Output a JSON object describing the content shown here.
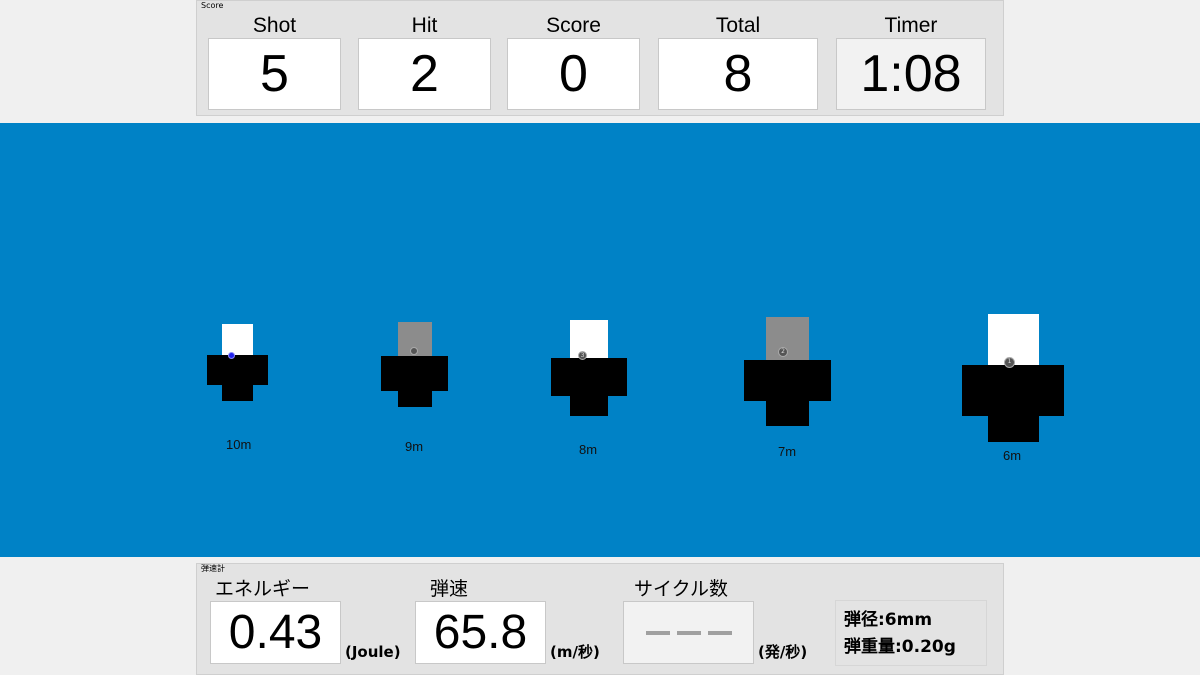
{
  "score_panel": {
    "caption": "Score",
    "columns": [
      {
        "label": "Shot",
        "value": "5"
      },
      {
        "label": "Hit",
        "value": "2"
      },
      {
        "label": "Score",
        "value": "0"
      },
      {
        "label": "Total",
        "value": "8"
      },
      {
        "label": "Timer",
        "value": "1:08"
      }
    ]
  },
  "field": {
    "background_color": "#0082c6",
    "targets": [
      {
        "distance": "10m",
        "card_color": "#ffffff",
        "hole_label": "",
        "hole_color": "blue"
      },
      {
        "distance": "9m",
        "card_color": "#8c8c8c",
        "hole_label": "",
        "hole_color": "gray"
      },
      {
        "distance": "8m",
        "card_color": "#ffffff",
        "hole_label": "3",
        "hole_color": "gray"
      },
      {
        "distance": "7m",
        "card_color": "#8c8c8c",
        "hole_label": "2",
        "hole_color": "gray"
      },
      {
        "distance": "6m",
        "card_color": "#ffffff",
        "hole_label": "1",
        "hole_color": "gray"
      }
    ]
  },
  "chrono_panel": {
    "caption": "弾速計",
    "energy": {
      "label": "エネルギー",
      "value": "0.43",
      "unit": "(Joule)"
    },
    "speed": {
      "label": "弾速",
      "value": "65.8",
      "unit": "(m/秒)"
    },
    "cycle": {
      "label": "サイクル数",
      "value": "---",
      "unit": "(発/秒)"
    },
    "spec": {
      "caliber": "弾径:6mm",
      "weight": "弾重量:0.20g"
    }
  }
}
